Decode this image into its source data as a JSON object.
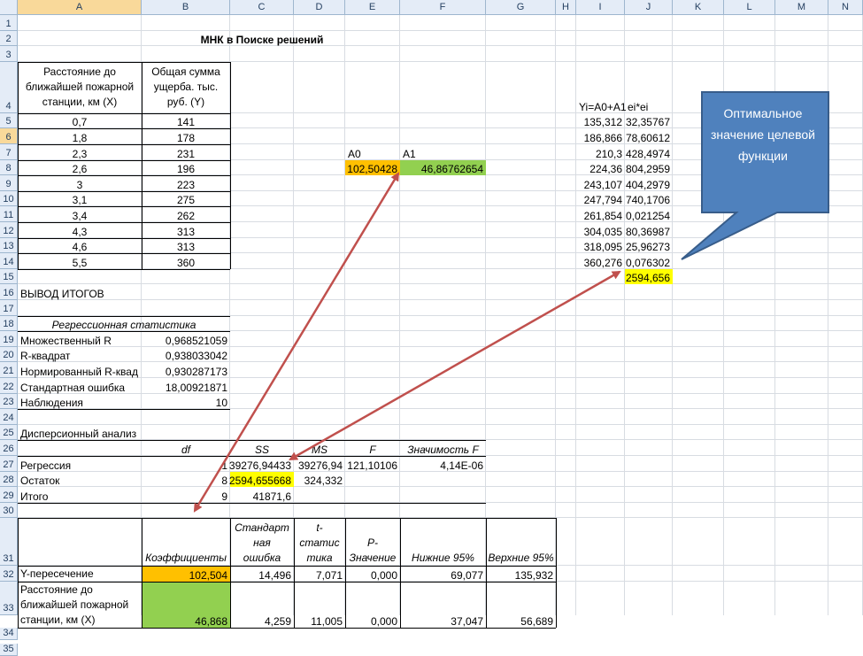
{
  "columns": [
    "A",
    "B",
    "C",
    "D",
    "E",
    "F",
    "G",
    "H",
    "I",
    "J",
    "K",
    "L",
    "M",
    "N"
  ],
  "rows": [
    "1",
    "2",
    "3",
    "4",
    "5",
    "6",
    "7",
    "8",
    "9",
    "10",
    "11",
    "12",
    "13",
    "14",
    "15",
    "16",
    "17",
    "18",
    "19",
    "20",
    "21",
    "22",
    "23",
    "24",
    "25",
    "26",
    "27",
    "28",
    "29",
    "30",
    "31",
    "32",
    "33",
    "34",
    "35"
  ],
  "selected_column": "A",
  "selected_row": "6",
  "title": "МНК в Поиске решений",
  "data_table": {
    "header_x": "Расстояние до ближайшей пожарной станции, км (X)",
    "header_y": "Общая сумма ущерба. тыс. руб. (Y)",
    "x": [
      "0,7",
      "1,8",
      "2,3",
      "2,6",
      "3",
      "3,1",
      "3,4",
      "4,3",
      "4,6",
      "5,5"
    ],
    "y": [
      "141",
      "178",
      "231",
      "196",
      "223",
      "275",
      "262",
      "313",
      "313",
      "360"
    ]
  },
  "params": {
    "a0_label": "A0",
    "a1_label": "A1",
    "a0_value": "102,50428",
    "a1_value": "46,86762654"
  },
  "calc": {
    "yi_header": "Yi=A0+A1",
    "e_header": "ei*ei",
    "yi": [
      "135,312",
      "186,866",
      "210,3",
      "224,36",
      "243,107",
      "247,794",
      "261,854",
      "304,035",
      "318,095",
      "360,276"
    ],
    "e": [
      "32,35767",
      "78,60612",
      "428,4974",
      "804,2959",
      "404,2979",
      "740,1706",
      "0,021254",
      "80,36987",
      "25,96273",
      "0,076302"
    ],
    "sum": "2594,656"
  },
  "callout": "Оптимальное значение целевой функции",
  "summary": {
    "title": "ВЫВОД ИТОГОВ",
    "reg_stat": "Регрессионная статистика",
    "rows": [
      {
        "label": "Множественный R",
        "value": "0,968521059"
      },
      {
        "label": "R-квадрат",
        "value": "0,938033042"
      },
      {
        "label": "Нормированный R-квад",
        "value": "0,930287173"
      },
      {
        "label": "Стандартная ошибка",
        "value": "18,00921871"
      },
      {
        "label": "Наблюдения",
        "value": "10"
      }
    ]
  },
  "anova": {
    "title": "Дисперсионный анализ",
    "headers": [
      "df",
      "SS",
      "MS",
      "F",
      "Значимость F"
    ],
    "rows": [
      {
        "label": "Регрессия",
        "df": "1",
        "ss": "39276,94433",
        "ms": "39276,94",
        "f": "121,10106",
        "sig": "4,14E-06"
      },
      {
        "label": "Остаток",
        "df": "8",
        "ss": "2594,655668",
        "ms": "324,332",
        "f": "",
        "sig": ""
      },
      {
        "label": "Итого",
        "df": "9",
        "ss": "41871,6",
        "ms": "",
        "f": "",
        "sig": ""
      }
    ]
  },
  "coef": {
    "headers": [
      "Коэффициенты",
      "Стандартная ошибка",
      "t-статистика",
      "P-Значение",
      "Нижние 95%",
      "Верхние 95%"
    ],
    "header_lines": [
      [
        "Коэффициенты"
      ],
      [
        "Стандарт",
        "ная",
        "ошибка"
      ],
      [
        "t-",
        "статис",
        "тика"
      ],
      [
        "P-",
        "Значение"
      ],
      [
        "Нижние 95%"
      ],
      [
        "Верхние 95%"
      ]
    ],
    "rows": [
      {
        "label": "Y-пересечение",
        "label_lines": [
          "Y-пересечение"
        ],
        "values": [
          "102,504",
          "14,496",
          "7,071",
          "0,000",
          "69,077",
          "135,932"
        ]
      },
      {
        "label": "Расстояние до ближайшей пожарной станции, км (X)",
        "label_lines": [
          "Расстояние до",
          "ближайшей пожарной",
          "станции, км (X)"
        ],
        "values": [
          "46,868",
          "4,259",
          "11,005",
          "0,000",
          "37,047",
          "56,689"
        ]
      }
    ]
  },
  "colors": {
    "orange": "#ffc000",
    "green": "#92d050",
    "yellow": "#ffff00",
    "callout": "#4f81bd",
    "arrow": "#c0504d"
  }
}
